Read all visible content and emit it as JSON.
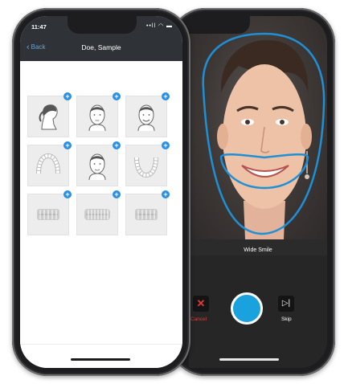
{
  "left_phone": {
    "status": {
      "time": "11:47",
      "icons": "••ll ◠ ▬"
    },
    "nav": {
      "back_label": "Back",
      "title": "Doe, Sample"
    },
    "tiles": [
      {
        "icon": "profile-head-icon"
      },
      {
        "icon": "front-face-icon"
      },
      {
        "icon": "smiling-face-icon"
      },
      {
        "icon": "upper-arch-icon"
      },
      {
        "icon": "face-photo-icon"
      },
      {
        "icon": "lower-arch-icon"
      },
      {
        "icon": "right-bite-icon"
      },
      {
        "icon": "front-bite-icon"
      },
      {
        "icon": "left-bite-icon"
      }
    ],
    "add_symbol": "+"
  },
  "right_phone": {
    "caption": "Wide Smile",
    "cancel_label": "Cancel",
    "skip_label": "Skip",
    "cancel_icon": "✕",
    "skip_icon": "▷|"
  },
  "colors": {
    "nav_bg": "#2f3236",
    "accent_blue": "#2a8fe0",
    "guide_outline": "#1f8fd6",
    "shutter": "#1aa2df",
    "cancel_red": "#e23b3b"
  }
}
